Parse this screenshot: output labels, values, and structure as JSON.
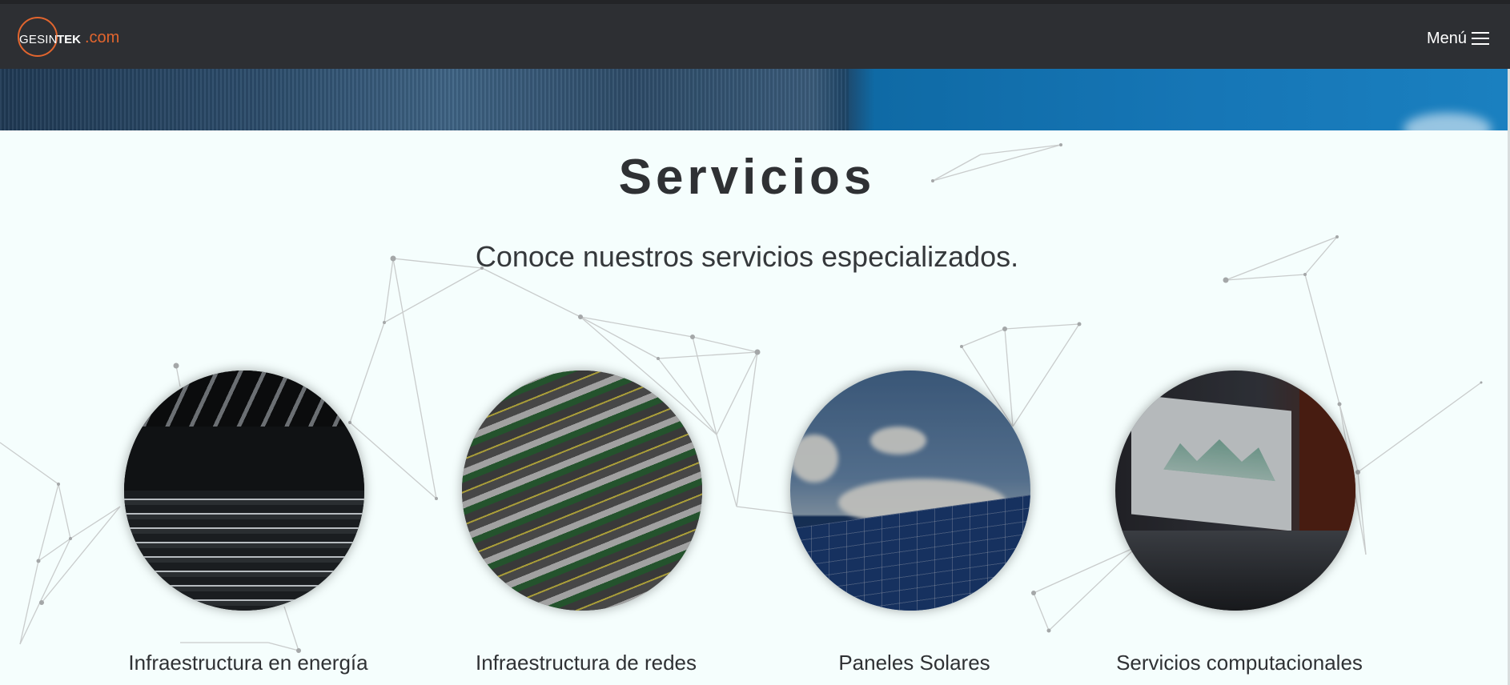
{
  "header": {
    "logo_part1": "GESIN",
    "logo_part2": "TEK",
    "logo_part3": ".com",
    "menu_label": "Menú"
  },
  "section": {
    "title": "Servicios",
    "subtitle": "Conoce nuestros servicios especializados."
  },
  "services": [
    {
      "label": "Infraestructura en energía"
    },
    {
      "label": "Infraestructura de redes"
    },
    {
      "label": "Paneles Solares"
    },
    {
      "label": "Servicios computacionales"
    }
  ],
  "colors": {
    "header_bg": "#2d2f33",
    "accent": "#e2652e",
    "page_bg": "#f5fefd",
    "text": "#2f3134"
  }
}
